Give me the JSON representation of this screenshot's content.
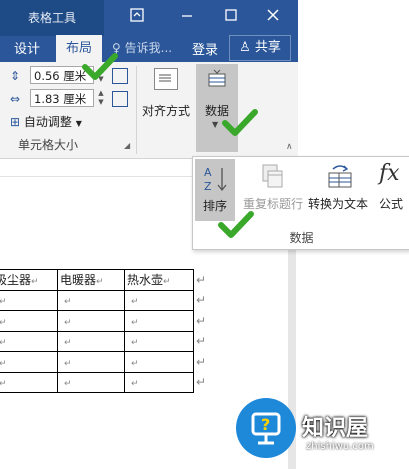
{
  "titlebar": {
    "tool_context": "表格工具",
    "tabs": {
      "design": "设计",
      "layout": "布局"
    },
    "tell_me": "告诉我...",
    "login": "登录",
    "share": "共享"
  },
  "ribbon": {
    "cell_size": {
      "height_value": "0.56 厘米",
      "width_value": "1.83 厘米",
      "autofit": "自动调整",
      "group_label": "单元格大小"
    },
    "alignment": {
      "label": "对齐方式"
    },
    "data": {
      "label": "数据"
    }
  },
  "data_panel": {
    "sort": "排序",
    "repeat_header": "重复标题行",
    "convert": "转换为文本",
    "formula": "公式",
    "group_label": "数据"
  },
  "table": {
    "headers": [
      "吸尘器",
      "电暖器",
      "热水壶"
    ],
    "row_count": 6,
    "cell_mark": "↵"
  },
  "watermark": {
    "brand": "知识屋",
    "url": "zhishiwu.com"
  },
  "colors": {
    "accent": "#2b579a",
    "check": "#3aa82b",
    "pressed": "#c6c6c6"
  }
}
